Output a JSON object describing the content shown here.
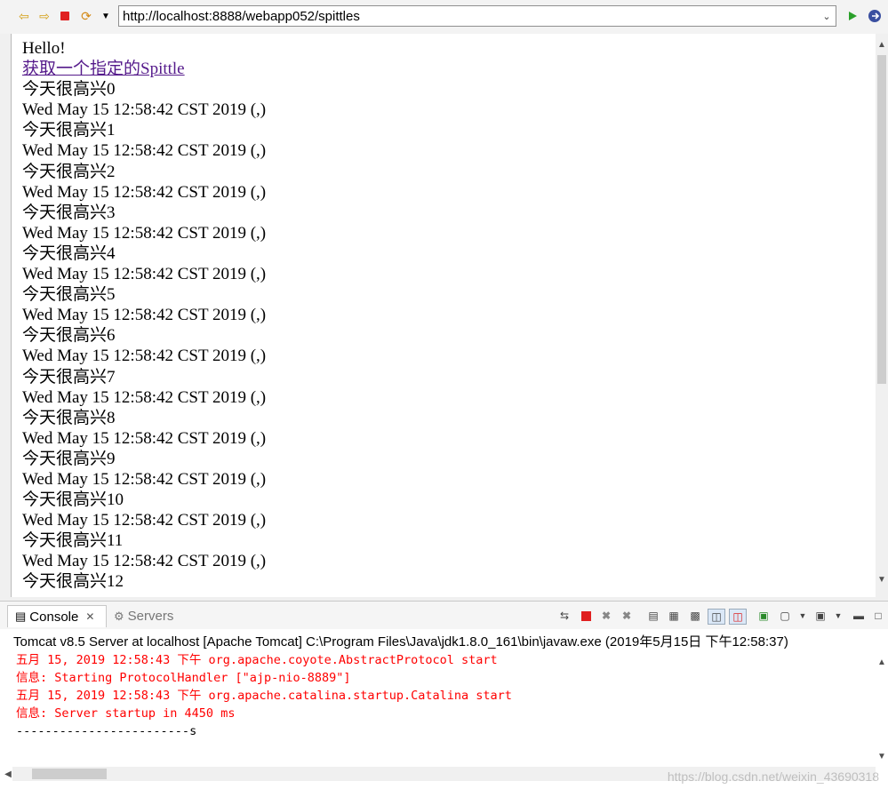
{
  "toolbar": {
    "back_icon": "arrow-left-icon",
    "forward_icon": "arrow-right-icon",
    "stop_icon": "stop-icon",
    "refresh_icon": "refresh-icon",
    "menu_icon": "chevron-down-icon",
    "go_icon": "play-icon",
    "url": "http://localhost:8888/webapp052/spittles"
  },
  "page": {
    "greeting": "Hello!",
    "link_text": "获取一个指定的Spittle",
    "lines": [
      "今天很高兴0",
      "Wed May 15 12:58:42 CST 2019 (,)",
      "今天很高兴1",
      "Wed May 15 12:58:42 CST 2019 (,)",
      "今天很高兴2",
      "Wed May 15 12:58:42 CST 2019 (,)",
      "今天很高兴3",
      "Wed May 15 12:58:42 CST 2019 (,)",
      "今天很高兴4",
      "Wed May 15 12:58:42 CST 2019 (,)",
      "今天很高兴5",
      "Wed May 15 12:58:42 CST 2019 (,)",
      "今天很高兴6",
      "Wed May 15 12:58:42 CST 2019 (,)",
      "今天很高兴7",
      "Wed May 15 12:58:42 CST 2019 (,)",
      "今天很高兴8",
      "Wed May 15 12:58:42 CST 2019 (,)",
      "今天很高兴9",
      "Wed May 15 12:58:42 CST 2019 (,)",
      "今天很高兴10",
      "Wed May 15 12:58:42 CST 2019 (,)",
      "今天很高兴11",
      "Wed May 15 12:58:42 CST 2019 (,)",
      "今天很高兴12"
    ]
  },
  "console": {
    "tabs": {
      "console": "Console",
      "servers": "Servers"
    },
    "title": "Tomcat v8.5 Server at localhost [Apache Tomcat] C:\\Program Files\\Java\\jdk1.8.0_161\\bin\\javaw.exe (2019年5月15日 下午12:58:37)",
    "lines": [
      {
        "text": "五月 15, 2019 12:58:43 下午 org.apache.coyote.AbstractProtocol start",
        "kind": "err"
      },
      {
        "text": "信息: Starting ProtocolHandler [\"ajp-nio-8889\"]",
        "kind": "err"
      },
      {
        "text": "五月 15, 2019 12:58:43 下午 org.apache.catalina.startup.Catalina start",
        "kind": "err"
      },
      {
        "text": "信息: Server startup in 4450 ms",
        "kind": "err"
      },
      {
        "text": "------------------------s",
        "kind": "out"
      }
    ],
    "watermark": "https://blog.csdn.net/weixin_43690318"
  },
  "colors": {
    "stderr": "#ff0000",
    "link_visited": "#551a8b"
  }
}
